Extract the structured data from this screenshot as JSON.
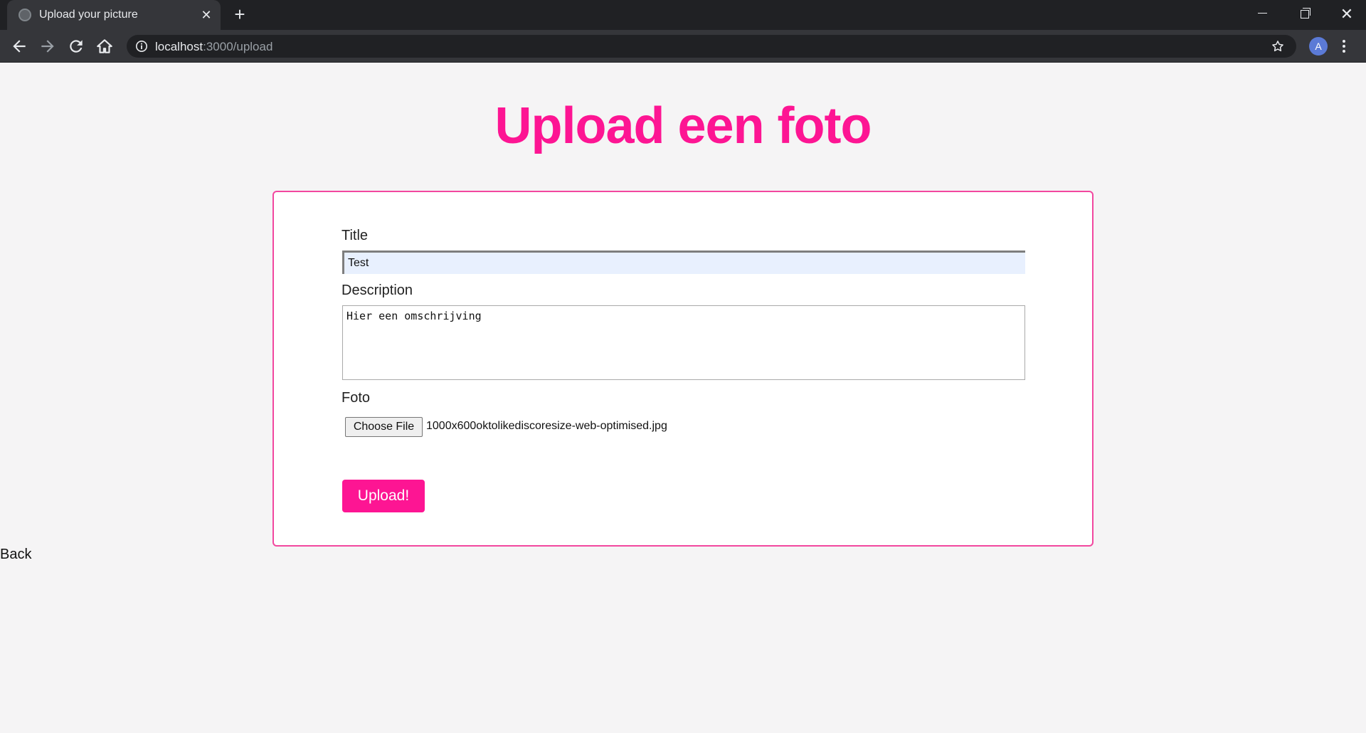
{
  "browser": {
    "tab_title": "Upload your picture",
    "tab_close_glyph": "✕",
    "new_tab_glyph": "+",
    "close_window_glyph": "✕",
    "url_host": "localhost",
    "url_path": ":3000/upload",
    "profile_initial": "A",
    "icons": [
      "globe-icon",
      "back-arrow-icon",
      "forward-arrow-icon",
      "reload-icon",
      "home-icon",
      "info-icon",
      "star-icon",
      "kebab-menu-icon",
      "minimize-icon",
      "maximize-icon",
      "close-icon"
    ]
  },
  "page": {
    "heading": "Upload een foto",
    "accent_color": "#fd1593",
    "form": {
      "title_label": "Title",
      "title_value": "Test",
      "description_label": "Description",
      "description_value": "Hier een omschrijving",
      "foto_label": "Foto",
      "file_button_label": "Choose File",
      "file_name": "1000x600oktolikediscoresize-web-optimised.jpg",
      "submit_label": "Upload!"
    },
    "back_link": "Back"
  }
}
